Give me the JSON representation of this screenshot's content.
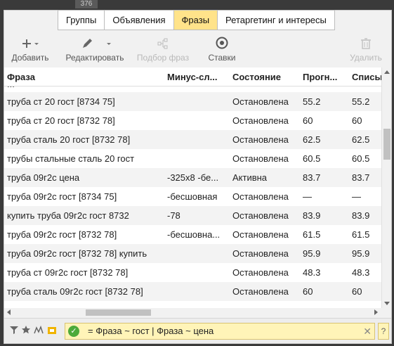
{
  "top_badge": "376",
  "tabs": [
    {
      "label": "Группы"
    },
    {
      "label": "Объявления"
    },
    {
      "label": "Фразы",
      "active": true
    },
    {
      "label": "Ретаргетинг и интересы"
    }
  ],
  "toolbar": {
    "add_label": "Добавить",
    "edit_label": "Редактировать",
    "phrase_select_label": "Подбор фраз",
    "bids_label": "Ставки",
    "delete_label": "Удалить"
  },
  "table": {
    "columns": [
      "Фраза",
      "Минус-сл...",
      "Состояние",
      "Прогн...",
      "Списыва"
    ],
    "partial_row": "...",
    "rows": [
      {
        "phrase": "труба ст 20 гост [8734 75]",
        "minus": "",
        "state": "Остановлена",
        "forecast": "55.2",
        "charge": "55.2"
      },
      {
        "phrase": "труба ст 20 гост [8732 78]",
        "minus": "",
        "state": "Остановлена",
        "forecast": "60",
        "charge": "60"
      },
      {
        "phrase": "труба сталь 20 гост [8732 78]",
        "minus": "",
        "state": "Остановлена",
        "forecast": "62.5",
        "charge": "62.5"
      },
      {
        "phrase": "трубы стальные сталь 20 гост",
        "minus": "",
        "state": "Остановлена",
        "forecast": "60.5",
        "charge": "60.5"
      },
      {
        "phrase": "труба 09г2с цена",
        "minus": "-325х8 -бе...",
        "state": "Активна",
        "forecast": "83.7",
        "charge": "83.7"
      },
      {
        "phrase": "труба 09г2с гост [8734 75]",
        "minus": "-бесшовная",
        "state": "Остановлена",
        "forecast": "—",
        "charge": "—"
      },
      {
        "phrase": "купить труба 09г2с гост 8732",
        "minus": "-78",
        "state": "Остановлена",
        "forecast": "83.9",
        "charge": "83.9"
      },
      {
        "phrase": "труба 09г2с гост [8732 78]",
        "minus": "-бесшовна...",
        "state": "Остановлена",
        "forecast": "61.5",
        "charge": "61.5"
      },
      {
        "phrase": "труба 09г2с гост [8732 78] купить",
        "minus": "",
        "state": "Остановлена",
        "forecast": "95.9",
        "charge": "95.9"
      },
      {
        "phrase": "труба ст 09г2с гост [8732 78]",
        "minus": "",
        "state": "Остановлена",
        "forecast": "48.3",
        "charge": "48.3"
      },
      {
        "phrase": "труба сталь 09г2с гост [8732 78]",
        "minus": "",
        "state": "Остановлена",
        "forecast": "60",
        "charge": "60"
      }
    ]
  },
  "filter": {
    "expression": "= Фраза ~ гост | Фраза ~ цена",
    "clear_glyph": "✕",
    "help_glyph": "?"
  },
  "colors": {
    "active_tab": "#ffe38a",
    "filter_bg": "#fff4b8",
    "ok_green": "#4caa3a"
  }
}
